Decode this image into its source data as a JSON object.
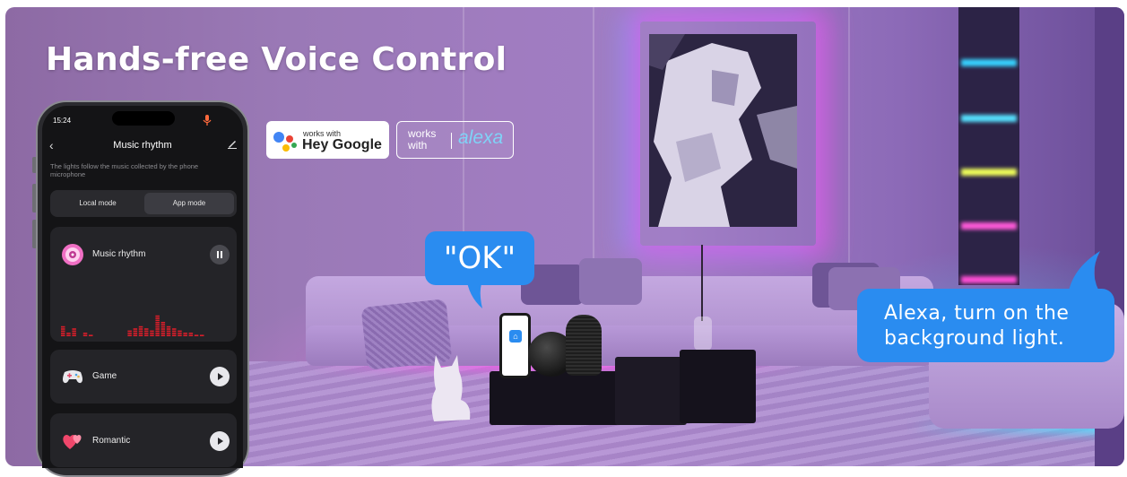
{
  "headline": "Hands-free Voice Control",
  "badges": {
    "google_small": "works with",
    "google_big": "Hey Google",
    "alexa_works": "works",
    "alexa_with": "with",
    "alexa_logo": "alexa"
  },
  "bubbles": {
    "ok": "\"OK\"",
    "alexa_line1": "Alexa, turn on the",
    "alexa_line2": "background light."
  },
  "phone": {
    "status_time": "15:24",
    "screen_title": "Music rhythm",
    "description": "The lights follow the music collected by the phone microphone",
    "modes": [
      "Local mode",
      "App mode"
    ],
    "selected_mode": "App mode",
    "cards": [
      {
        "label": "Music rhythm",
        "icon": "vinyl-disc-icon",
        "control": "pause"
      },
      {
        "label": "Game",
        "icon": "gamepad-icon",
        "control": "play"
      },
      {
        "label": "Romantic",
        "icon": "hearts-icon",
        "control": "play"
      }
    ]
  },
  "colors": {
    "bubble_blue": "#2a8cf0",
    "eq_red": "#d81e2a",
    "alexa_cyan": "#7fd3f7"
  }
}
